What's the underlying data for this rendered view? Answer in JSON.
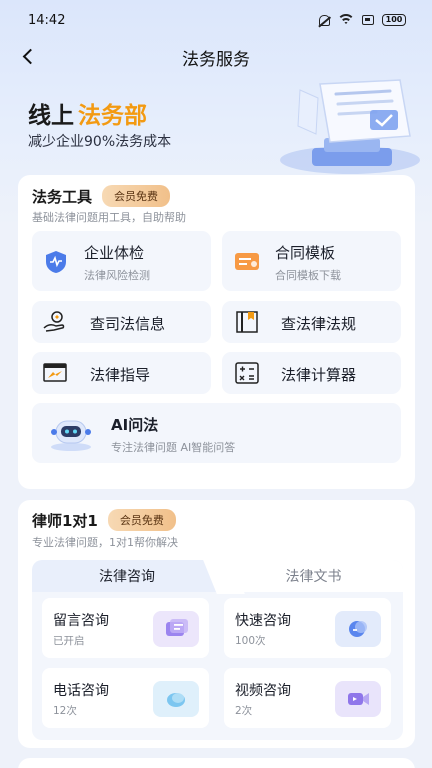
{
  "status_bar": {
    "time": "14:42",
    "battery": "100"
  },
  "nav": {
    "title": "法务服务"
  },
  "banner": {
    "title_plain": "线上",
    "title_highlight": "法务部",
    "subtitle": "减少企业90%法务成本"
  },
  "tools": {
    "title": "法务工具",
    "badge": "会员免费",
    "description": "基础法律问题用工具，自助帮助",
    "enterprise_check": {
      "label": "企业体检",
      "sub": "法律风险检测"
    },
    "contract_template": {
      "label": "合同模板",
      "sub": "合同模板下载"
    },
    "judicial_info": {
      "label": "查司法信息"
    },
    "laws": {
      "label": "查法律法规"
    },
    "guidance": {
      "label": "法律指导"
    },
    "calculator": {
      "label": "法律计算器"
    },
    "ai": {
      "label": "AI问法",
      "sub": "专注法律问题 AI智能问答"
    }
  },
  "lawyer": {
    "title": "律师1对1",
    "badge": "会员免费",
    "description": "专业法律问题，1对1帮你解决",
    "tabs": [
      "法律咨询",
      "法律文书"
    ],
    "items": [
      {
        "label": "留言咨询",
        "sub": "已开启"
      },
      {
        "label": "快速咨询",
        "sub": "100次"
      },
      {
        "label": "电话咨询",
        "sub": "12次"
      },
      {
        "label": "视频咨询",
        "sub": "2次"
      }
    ]
  },
  "colors": {
    "accent": "#f39a12",
    "primary": "#3f6fe8",
    "background": "#eef2fa"
  }
}
